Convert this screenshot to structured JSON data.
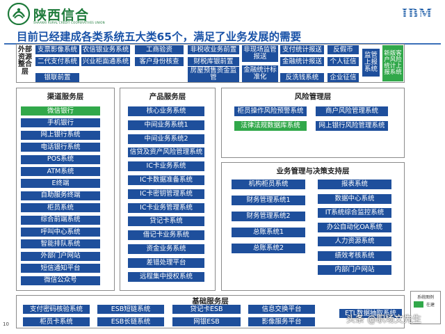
{
  "logo": {
    "cn": "陕西信合",
    "en": "SHAANXI RURAL CREDIT COOPERATIVES UNION"
  },
  "ibm": "IBM",
  "headline": "目前已经建成各类系统五大类65个，满足了业务发展的需要",
  "external": {
    "label": "外部资源整合层",
    "items": [
      "支票影像系统",
      "农信银业务系统",
      "工商验资",
      "非税收业务前置",
      "非现场监管报送",
      "支付统计报送",
      "反假币",
      "二代支付系统",
      "兴业柜面通系统",
      "客户身份核查",
      "财税库银前置",
      "金融统计报送",
      "个人征信",
      "银联前置",
      "房屋预售资金监管",
      "金融统计标准化",
      "反洗钱系统",
      "企业征信",
      "监管上报系统",
      "新版客户风险统计上报系统"
    ]
  },
  "channel": {
    "title": "渠道服务层",
    "items": [
      "微信银行",
      "手机银行",
      "网上银行系统",
      "电话银行系统",
      "POS系统",
      "ATM系统",
      "E终端",
      "自助服务终端",
      "柜员系统",
      "综合前端系统",
      "呼叫中心系统",
      "智能排队系统",
      "外部门户网站",
      "短信通知平台",
      "微信公众号"
    ]
  },
  "product": {
    "title": "产品服务层",
    "items": [
      "核心业务系统",
      "中间业务系统1",
      "中间业务系统2",
      "信贷及资产风险管理系统",
      "IC卡业务系统",
      "IC卡数据准备系统",
      "IC卡密钥管理系统",
      "IC卡业务管理系统",
      "贷记卡系统",
      "借记卡业务系统",
      "资金业务系统",
      "差错处理平台",
      "远程集中授权系统"
    ]
  },
  "risk": {
    "title": "风险管理层",
    "items": [
      "柜员操作风险预警系统",
      "商户风险管理系统",
      "法律法规数据库系统",
      "网上银行风险管理系统"
    ]
  },
  "decision": {
    "title": "业务管理与决策支持层",
    "left": [
      "机构柜员系统",
      "财务管理系统1",
      "财务管理系统2",
      "总账系统1",
      "总账系统2"
    ],
    "right": [
      "报表系统",
      "数据中心系统",
      "IT系统综合监控系统",
      "办公自动化OA系统",
      "人力资源系统",
      "绩效考核系统",
      "内部门户网站"
    ]
  },
  "base": {
    "title": "基础服务层",
    "items": [
      "支付密码核验系统",
      "ESB短链系统",
      "贷记卡ESB",
      "信息交换平台",
      "ETL数据抽取系统",
      "柜员卡系统",
      "ESB长链系统",
      "网银ESB",
      "影像服务平台"
    ]
  },
  "legend": {
    "title": "系统图例",
    "label": "在建"
  },
  "page_number": "10",
  "watermark": "头条 @职场文先生",
  "colors": {
    "blue_box": "#1e4f9c",
    "green_box": "#31a84a",
    "headline": "#1a53a8",
    "brand_green": "#1d7a3a"
  }
}
